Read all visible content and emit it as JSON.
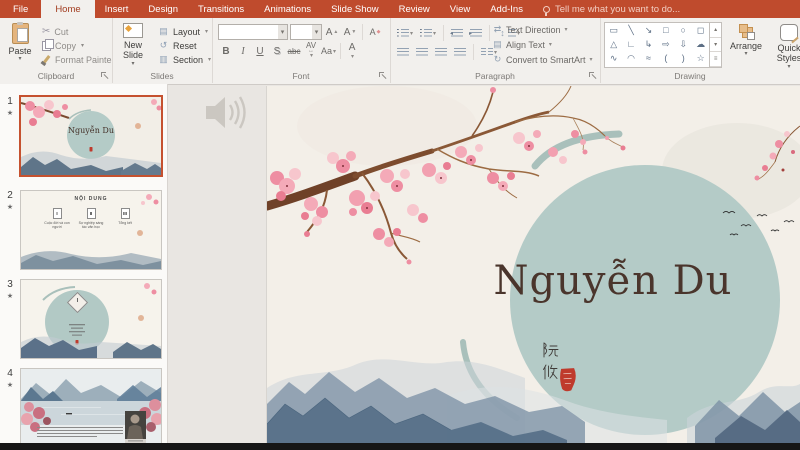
{
  "ribbon": {
    "tabs": [
      "File",
      "Home",
      "Insert",
      "Design",
      "Transitions",
      "Animations",
      "Slide Show",
      "Review",
      "View",
      "Add-Ins"
    ],
    "active_tab": "Home",
    "tell_me": "Tell me what you want to do...",
    "clipboard": {
      "label": "Clipboard",
      "paste": "Paste",
      "cut": "Cut",
      "copy": "Copy",
      "format_painter": "Format Painter"
    },
    "slides_group": {
      "label": "Slides",
      "new_slide": "New Slide",
      "layout": "Layout",
      "reset": "Reset",
      "section": "Section"
    },
    "font_group": {
      "label": "Font",
      "bold": "B",
      "italic": "I",
      "underline": "U",
      "shadow": "S",
      "strikethrough": "abc",
      "char_spacing": "AV",
      "change_case": "Aa",
      "font_color": "A",
      "grow_font": "A",
      "shrink_font": "A"
    },
    "paragraph_group": {
      "label": "Paragraph",
      "text_direction": "Text Direction",
      "align_text": "Align Text",
      "convert_smartart": "Convert to SmartArt"
    },
    "drawing_group": {
      "label": "Drawing",
      "arrange": "Arrange",
      "quick_styles": "Quick Styles",
      "shapes": [
        "▭",
        "╲",
        "↘",
        "□",
        "○",
        "◻",
        "△",
        "∟",
        "↳",
        "⇨",
        "⇩",
        "☁",
        "∿",
        "◠",
        "≈",
        "(",
        ")",
        "☆"
      ]
    }
  },
  "slide_panel": {
    "slides": [
      {
        "number": "1",
        "star": "★",
        "selected": true,
        "title": "Nguyễn Du"
      },
      {
        "number": "2",
        "star": "★",
        "selected": false,
        "title": "NỘI DUNG",
        "items": [
          {
            "num": "I",
            "text": "Cuộc đời và con người"
          },
          {
            "num": "II",
            "text": "Sự nghiệp sáng tác văn học"
          },
          {
            "num": "III",
            "text": "Tổng kết"
          }
        ]
      },
      {
        "number": "3",
        "star": "★",
        "selected": false,
        "marker": "I"
      },
      {
        "number": "4",
        "star": "★",
        "selected": false
      }
    ]
  },
  "slide": {
    "title": "Nguyễn Du",
    "chinese_name": "阮攸"
  },
  "colors": {
    "ribbon_red": "#bf4b2d",
    "circle_teal": "#b4cbc7",
    "title_brown": "#4a352c",
    "seal_red": "#bf3a2c",
    "mountain_blue": "#566f88",
    "blossom_pink": "#ee8ea2"
  }
}
